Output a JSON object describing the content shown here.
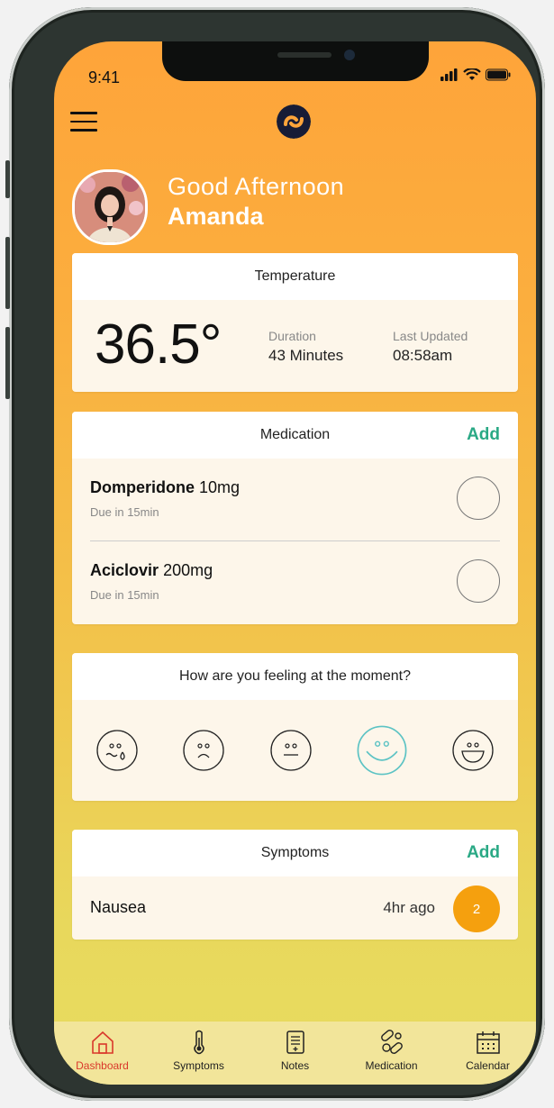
{
  "status": {
    "time": "9:41"
  },
  "greeting": {
    "line1": "Good Afternoon",
    "name": "Amanda"
  },
  "temperature": {
    "title": "Temperature",
    "value": "36.5°",
    "duration_label": "Duration",
    "duration_value": "43 Minutes",
    "updated_label": "Last Updated",
    "updated_value": "08:58am"
  },
  "medication": {
    "title": "Medication",
    "add_label": "Add",
    "items": [
      {
        "name": "Domperidone",
        "dose": "10mg",
        "due": "Due in 15min"
      },
      {
        "name": "Aciclovir",
        "dose": "200mg",
        "due": "Due in 15min"
      }
    ]
  },
  "feeling": {
    "question": "How are you feeling at the moment?",
    "faces": [
      "crying-face-icon",
      "sad-face-icon",
      "neutral-face-icon",
      "smile-face-icon",
      "laughing-face-icon"
    ],
    "selected_index": 3,
    "selected_color": "#5cc3c4"
  },
  "symptoms": {
    "title": "Symptoms",
    "add_label": "Add",
    "items": [
      {
        "name": "Nausea",
        "time": "4hr ago",
        "count": "2"
      }
    ]
  },
  "tabs": [
    {
      "label": "Dashboard",
      "icon": "home-icon",
      "active": true
    },
    {
      "label": "Symptoms",
      "icon": "thermometer-icon",
      "active": false
    },
    {
      "label": "Notes",
      "icon": "notes-icon",
      "active": false
    },
    {
      "label": "Medication",
      "icon": "pills-icon",
      "active": false
    },
    {
      "label": "Calendar",
      "icon": "calendar-icon",
      "active": false
    }
  ],
  "colors": {
    "accent_green": "#2aa985",
    "badge_orange": "#f5a00e",
    "active_tab_red": "#d9382b"
  }
}
